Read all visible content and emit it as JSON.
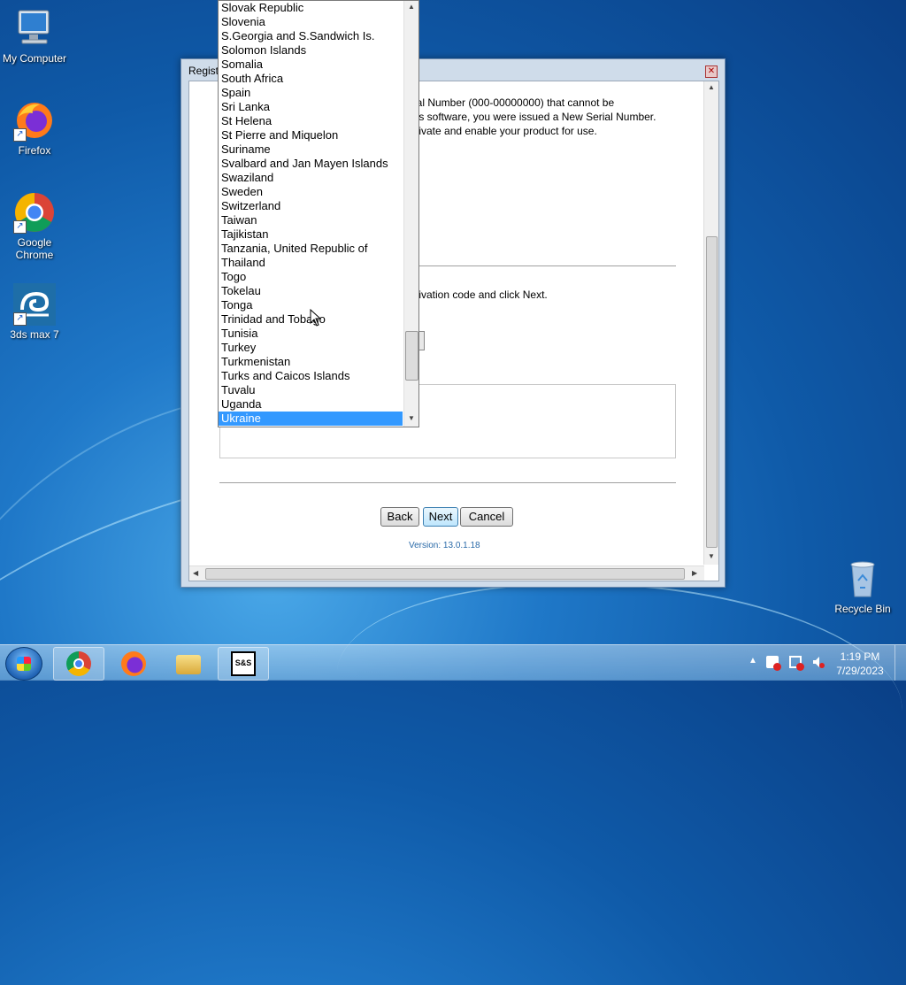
{
  "desktop": {
    "icons": [
      {
        "label": "My Computer"
      },
      {
        "label": "Firefox"
      },
      {
        "label": "Google Chrome"
      },
      {
        "label": "3ds max 7"
      },
      {
        "label": "Recycle Bin"
      }
    ]
  },
  "dialog": {
    "title": "Registe",
    "text_line1": "rial Number (000-00000000) that cannot be",
    "text_line2": "his software, you were issued a New Serial Number.",
    "text_line3": "ctivate and enable your product for use.",
    "text_activation": "ctivation code and click Next.",
    "back_label": "Back",
    "next_label": "Next",
    "cancel_label": "Cancel",
    "version": "Version: 13.0.1.18"
  },
  "country_list": {
    "items": [
      "Slovak Republic",
      "Slovenia",
      "S.Georgia and S.Sandwich Is.",
      "Solomon Islands",
      "Somalia",
      "South Africa",
      "Spain",
      "Sri Lanka",
      "St Helena",
      "St Pierre and Miquelon",
      "Suriname",
      "Svalbard and Jan Mayen Islands",
      "Swaziland",
      "Sweden",
      "Switzerland",
      "Taiwan",
      "Tajikistan",
      "Tanzania, United Republic of",
      "Thailand",
      "Togo",
      "Tokelau",
      "Tonga",
      "Trinidad and Tobago",
      "Tunisia",
      "Turkey",
      "Turkmenistan",
      "Turks and Caicos Islands",
      "Tuvalu",
      "Uganda",
      "Ukraine"
    ],
    "selected": "Ukraine"
  },
  "taskbar": {
    "time": "1:19 PM",
    "date": "7/29/2023",
    "app_label": "S&S"
  },
  "colors": {
    "selection": "#3399ff",
    "version_text": "#2a6aa8"
  }
}
